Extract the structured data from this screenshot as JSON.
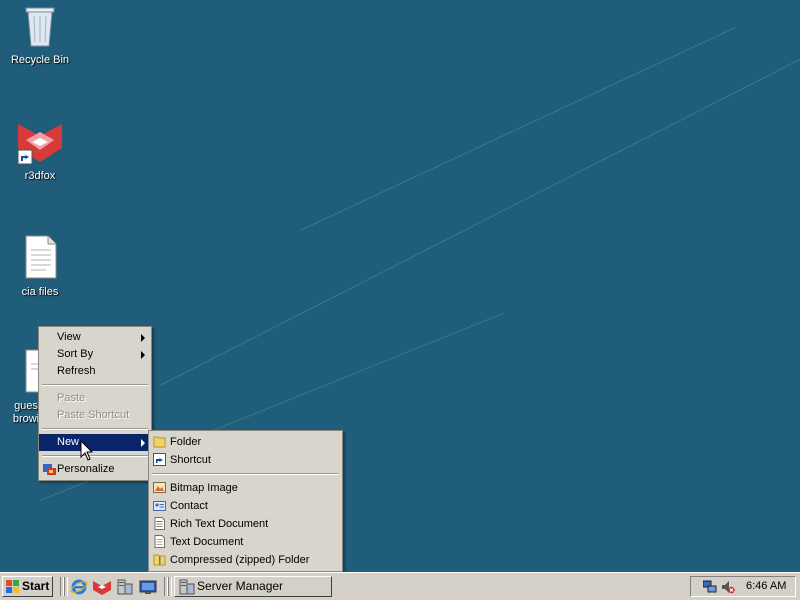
{
  "desktop": {
    "icons": [
      {
        "label": "Recycle Bin"
      },
      {
        "label": "r3dfox"
      },
      {
        "label": "cia files"
      },
      {
        "label": "gues browi"
      }
    ]
  },
  "context_menu": {
    "items": [
      {
        "label": "View",
        "has_submenu": true
      },
      {
        "label": "Sort By",
        "has_submenu": true
      },
      {
        "label": "Refresh"
      },
      {
        "label": "Paste",
        "disabled": true
      },
      {
        "label": "Paste Shortcut",
        "disabled": true
      },
      {
        "label": "New",
        "has_submenu": true,
        "highlighted": true
      },
      {
        "label": "Personalize"
      }
    ]
  },
  "new_submenu": {
    "items": [
      {
        "label": "Folder"
      },
      {
        "label": "Shortcut"
      },
      {
        "label": "Bitmap Image"
      },
      {
        "label": "Contact"
      },
      {
        "label": "Rich Text Document"
      },
      {
        "label": "Text Document"
      },
      {
        "label": "Compressed (zipped) Folder"
      }
    ]
  },
  "taskbar": {
    "start_label": "Start",
    "task_label": "Server Manager",
    "clock": "6:46 AM"
  },
  "colors": {
    "desktop": "#1f5d7a",
    "menu_bg": "#d8d5cc",
    "highlight": "#0a246a",
    "taskbar": "#d4d0c8"
  }
}
